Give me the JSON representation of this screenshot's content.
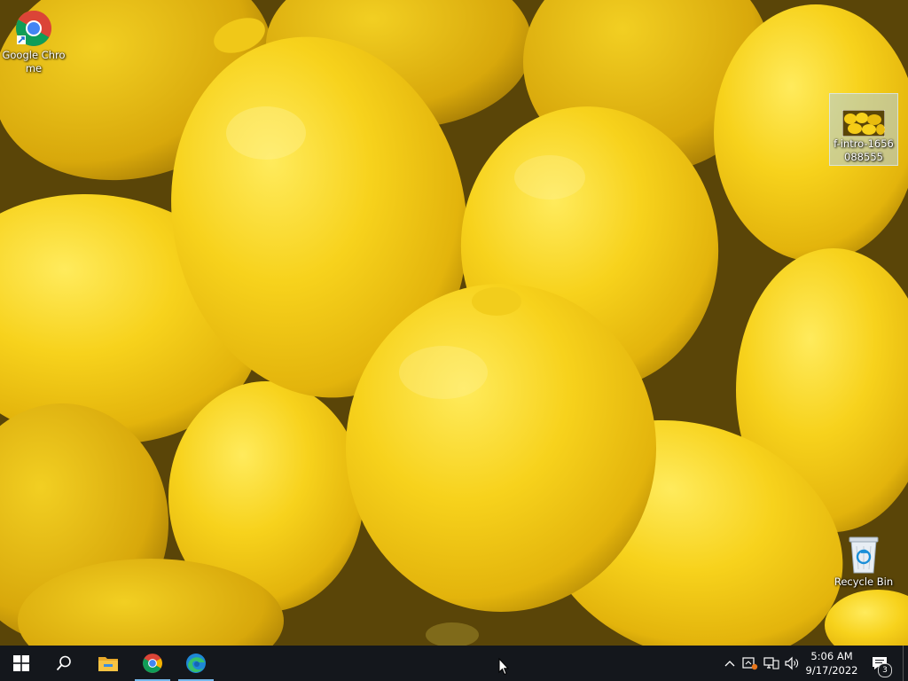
{
  "desktop": {
    "icons": [
      {
        "label": "Google Chrome",
        "icon": "chrome-icon"
      },
      {
        "label": "f-intro-1656088555",
        "icon": "image-file-icon"
      },
      {
        "label": "Recycle Bin",
        "icon": "recycle-bin-icon"
      }
    ]
  },
  "taskbar": {
    "pinned": [
      {
        "icon": "windows-start-icon"
      },
      {
        "icon": "search-icon"
      },
      {
        "icon": "file-explorer-icon"
      },
      {
        "icon": "chrome-icon"
      },
      {
        "icon": "edge-icon"
      }
    ],
    "tray": {
      "icons": [
        "chevron-up-icon",
        "meet-now-icon",
        "network-icon",
        "volume-icon"
      ],
      "time": "5:06 AM",
      "date": "9/17/2022",
      "notification_count": "3"
    }
  },
  "colors": {
    "taskbar": "#14171c",
    "accent": "#76b9ed",
    "lemon": "#f5cc16"
  }
}
